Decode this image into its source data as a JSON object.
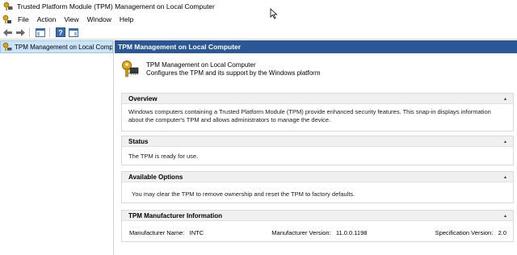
{
  "window": {
    "title": "Trusted Platform Module (TPM) Management on Local Computer"
  },
  "menu": {
    "items": [
      "File",
      "Action",
      "View",
      "Window",
      "Help"
    ]
  },
  "toolbar": {
    "buttons": [
      "back-icon",
      "forward-icon",
      "show-hide-console-tree-icon",
      "help-icon",
      "show-hide-action-pane-icon"
    ]
  },
  "tree": {
    "selected_label": "TPM Management on Local Comp"
  },
  "content": {
    "header": "TPM Management on Local Computer",
    "intro_title": "TPM Management on Local Computer",
    "intro_sub": "Configures the TPM and its support by the Windows platform",
    "overview": {
      "title": "Overview",
      "body": "Windows computers containing a Trusted Platform Module (TPM) provide enhanced security features. This snap-in displays information about the computer's TPM and allows administrators to manage the device."
    },
    "status": {
      "title": "Status",
      "body": "The TPM is ready for use."
    },
    "options": {
      "title": "Available Options",
      "body": "You may clear the TPM to remove ownership and reset the TPM to factory defaults."
    },
    "manufacturer": {
      "title": "TPM Manufacturer Information",
      "name_label": "Manufacturer Name:",
      "name_value": "INTC",
      "version_label": "Manufacturer Version:",
      "version_value": "11.0.0.1198",
      "spec_label": "Specification Version:",
      "spec_value": "2.0"
    },
    "collapse_glyph": "▴"
  }
}
